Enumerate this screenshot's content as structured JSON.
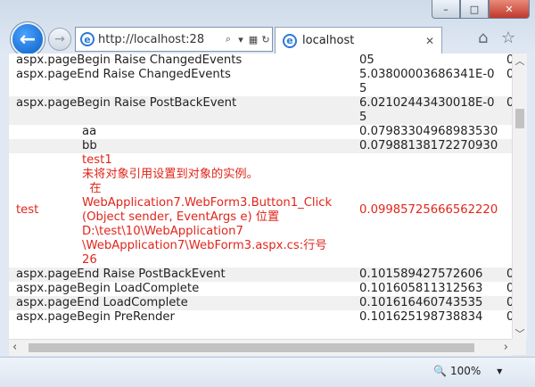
{
  "browser": {
    "address": "http://localhost:28",
    "tab_title": "localhost",
    "back_glyph": "←",
    "forward_glyph": "→",
    "search_icon_glyph": "⌕",
    "dropdown_glyph": "▾",
    "padlock_text": "",
    "stop_glyph": "✕",
    "refresh_glyph": "↻",
    "tab_close_glyph": "✕",
    "home_glyph": "⌂",
    "favorites_glyph": "☆",
    "minimize_glyph": "–",
    "maximize_glyph": "□",
    "close_glyph": "✕",
    "zoom": "100%",
    "zoom_dropdown": "▾"
  },
  "trace_rows": [
    {
      "indent": false,
      "label": "aspx.pageBegin Raise ChangedEvents",
      "value": "05",
      "third": "0",
      "alt": false,
      "red": false
    },
    {
      "indent": false,
      "label": "aspx.pageEnd Raise ChangedEvents",
      "value": "5.03800003686341E-05",
      "third": "0",
      "alt": false,
      "red": false
    },
    {
      "indent": false,
      "label": "aspx.pageBegin Raise PostBackEvent",
      "value": "6.02102443430018E-05",
      "third": "0",
      "alt": true,
      "red": false
    },
    {
      "indent": true,
      "label": "aa",
      "value": "0.07983304968983530",
      "third": "",
      "alt": false,
      "red": false
    },
    {
      "indent": true,
      "label": "bb",
      "value": "0.07988138172270930",
      "third": "",
      "alt": true,
      "red": false
    }
  ],
  "error_row": {
    "category": "test",
    "message_lines": [
      "test1",
      "未将对象引用设置到对象的实例。",
      "  在",
      "WebApplication7.WebForm3.Button1_Click",
      "(Object sender, EventArgs e) 位置",
      "D:\\test\\10\\WebApplication7",
      "\\WebApplication7\\WebForm3.aspx.cs:行号",
      "26"
    ],
    "value": "0.09985725666562220"
  },
  "trace_rows_after": [
    {
      "label": "aspx.pageEnd Raise PostBackEvent",
      "value": "0.101589427572606",
      "third": "0",
      "alt": true
    },
    {
      "label": "aspx.pageBegin LoadComplete",
      "value": "0.101605811312563",
      "third": "0",
      "alt": false
    },
    {
      "label": "aspx.pageEnd LoadComplete",
      "value": "0.101616460743535",
      "third": "0",
      "alt": true
    },
    {
      "label": "aspx.pageBegin PreRender",
      "value": "0.101625198738834",
      "third": "0",
      "alt": false
    }
  ]
}
